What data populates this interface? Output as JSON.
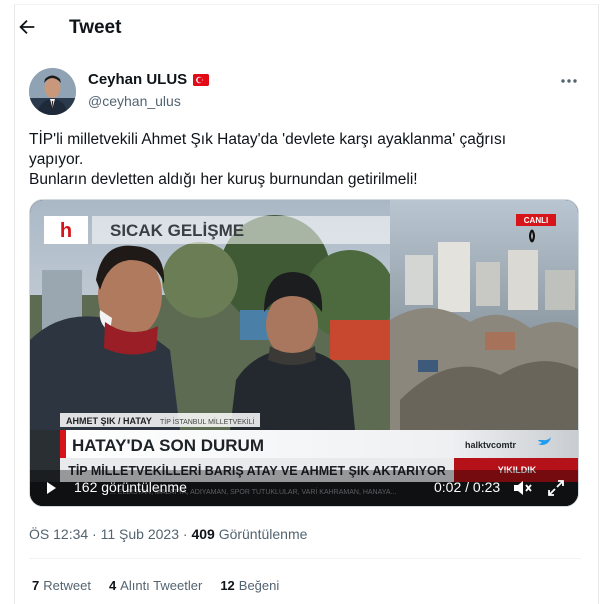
{
  "header": {
    "title": "Tweet"
  },
  "author": {
    "name": "Ceyhan ULUS",
    "handle": "@ceyhan_ulus"
  },
  "tweet": {
    "line1": "TİP'li milletvekili Ahmet Şık Hatay'da 'devlete karşı ayaklanma' çağrısı",
    "line2": "yapıyor.",
    "line3": "Bunların devletten aldığı her kuruş burnundan getirilmeli!"
  },
  "video": {
    "banner_top": "SICAK GELİŞME",
    "live_badge": "CANLI",
    "name_tag": "AHMET ŞIK / HATAY",
    "name_role": "TİP İSTANBUL MİLLETVEKİLİ",
    "headline": "HATAY'DA SON DURUM",
    "social": "halktvcomtr",
    "ticker": "TİP MİLLETVEKİLLERİ BARIŞ ATAY VE AHMET ŞIK AKTARIYOR",
    "ticker_right": "YIKILDIK",
    "scroll_text": "... ELBİSTAN, MALATYA, ADIYAMAN, SPOR TUTUKLULAR, VARİ KAHRAMAN, HANAYA...",
    "views_overlay": "162 görüntülenme",
    "time_current": "0:02",
    "time_total": "0:23",
    "colors": {
      "red": "#d7141a",
      "accent": "#1d9bf0"
    }
  },
  "meta": {
    "time": "ÖS 12:34",
    "sep": "·",
    "date": "11 Şub 2023",
    "views_count": "409",
    "views_label": "Görüntülenme"
  },
  "stats": {
    "retweets_count": "7",
    "retweets_label": "Retweet",
    "quotes_count": "4",
    "quotes_label": "Alıntı Tweetler",
    "likes_count": "12",
    "likes_label": "Beğeni"
  }
}
